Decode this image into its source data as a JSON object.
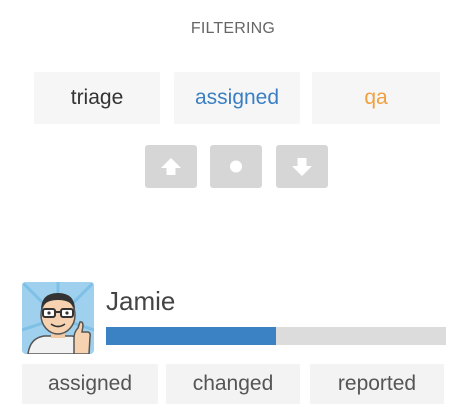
{
  "filtering": {
    "title": "FILTERING",
    "filters": [
      {
        "label": "triage",
        "color": "#333333"
      },
      {
        "label": "assigned",
        "color": "#3a7fc3"
      },
      {
        "label": "qa",
        "color": "#f0a040"
      }
    ]
  },
  "controls": {
    "button_color": "#d6d6d6",
    "icons": [
      "arrow-up-icon",
      "dot-icon",
      "arrow-down-icon"
    ]
  },
  "user": {
    "name": "Jamie",
    "progress_fraction": 0.5,
    "progress_color": "#3b82c4",
    "stats": [
      {
        "label": "assigned"
      },
      {
        "label": "changed"
      },
      {
        "label": "reported"
      }
    ]
  }
}
